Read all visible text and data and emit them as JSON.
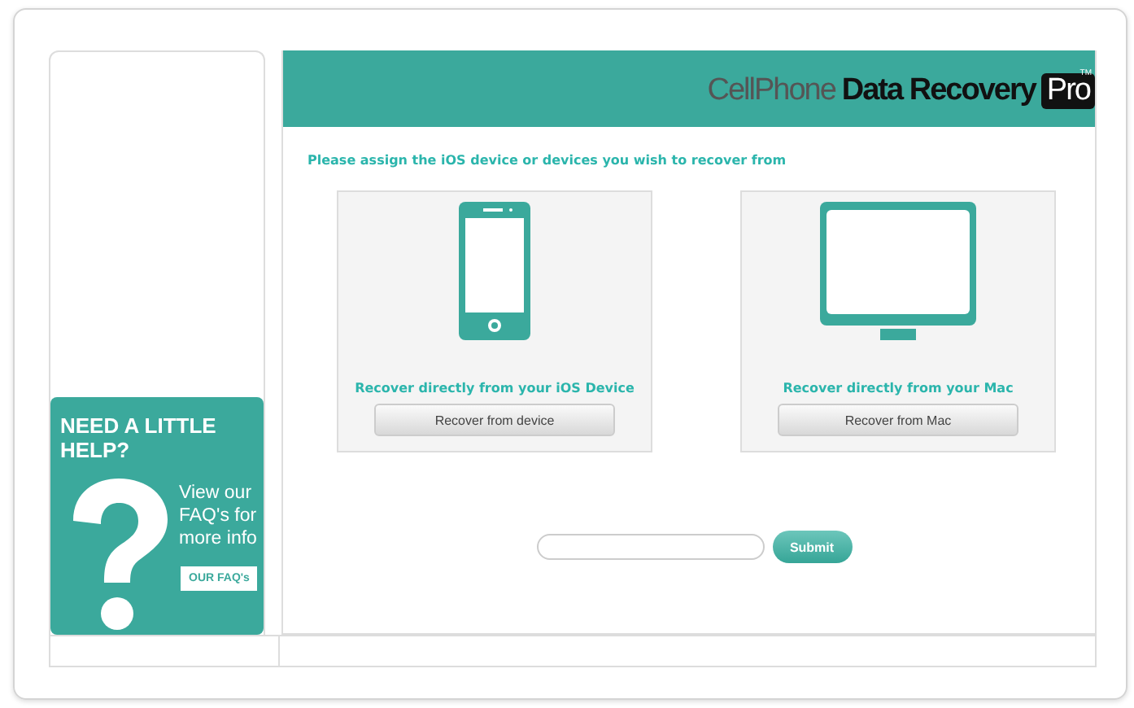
{
  "logo": {
    "light": "CellPhone",
    "bold": "Data Recovery",
    "badge": "Pro",
    "mark": "TM"
  },
  "prompt": "Please assign the iOS device or devices you wish to recover from",
  "options": [
    {
      "kind": "phone",
      "caption": "Recover directly from your iOS Device",
      "button": "Recover from device"
    },
    {
      "kind": "monitor",
      "caption": "Recover directly from your Mac",
      "button": "Recover from Mac"
    }
  ],
  "help": {
    "title": "NEED A LITTLE HELP?",
    "text": "View our FAQ's for more info",
    "button": "OUR FAQ's"
  },
  "submit": {
    "button": "Submit"
  }
}
